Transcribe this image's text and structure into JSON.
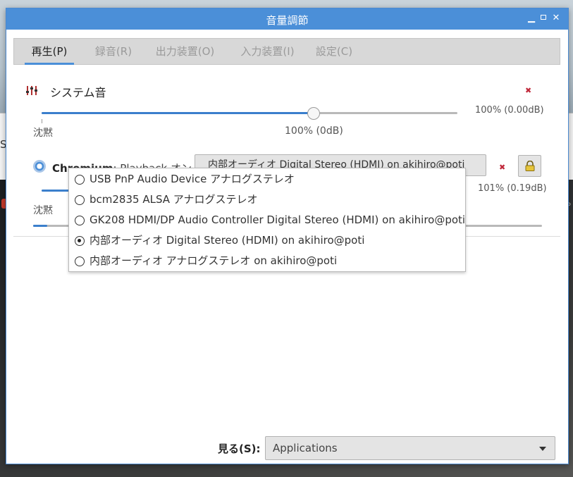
{
  "window": {
    "title": "音量調節"
  },
  "tabs": [
    {
      "label": "再生(P)",
      "active": true
    },
    {
      "label": "録音(R)",
      "active": false
    },
    {
      "label": "出力装置(O)",
      "active": false
    },
    {
      "label": "入力装置(I)",
      "active": false
    },
    {
      "label": "設定(C)",
      "active": false
    }
  ],
  "system_sound": {
    "label": "システム音",
    "volume_text": "100% (0.00dB)",
    "volume_fraction": 1.0,
    "mute_label": "沈黙",
    "center_label": "100% (0dB)"
  },
  "stream": {
    "app_name": "Chromium",
    "rest_label": ": Playback  オン",
    "device_selected": "内部オーディオ Digital Stereo (HDMI) on akihiro@poti",
    "volume_text": "101% (0.19dB)",
    "mute_label": "沈黙"
  },
  "device_menu": {
    "options": [
      {
        "label": "USB PnP Audio Device アナログステレオ",
        "selected": false
      },
      {
        "label": "bcm2835 ALSA アナログステレオ",
        "selected": false
      },
      {
        "label": "GK208 HDMI/DP Audio Controller Digital Stereo (HDMI) on akihiro@poti",
        "selected": false
      },
      {
        "label": "内部オーディオ Digital Stereo (HDMI) on akihiro@poti",
        "selected": true
      },
      {
        "label": "内部オーディオ アナログステレオ on akihiro@poti",
        "selected": false
      }
    ]
  },
  "footer": {
    "view_label": "見る(S):",
    "view_value": "Applications"
  },
  "colors": {
    "accent": "#4b8fd8",
    "mute": "#c0283a"
  }
}
